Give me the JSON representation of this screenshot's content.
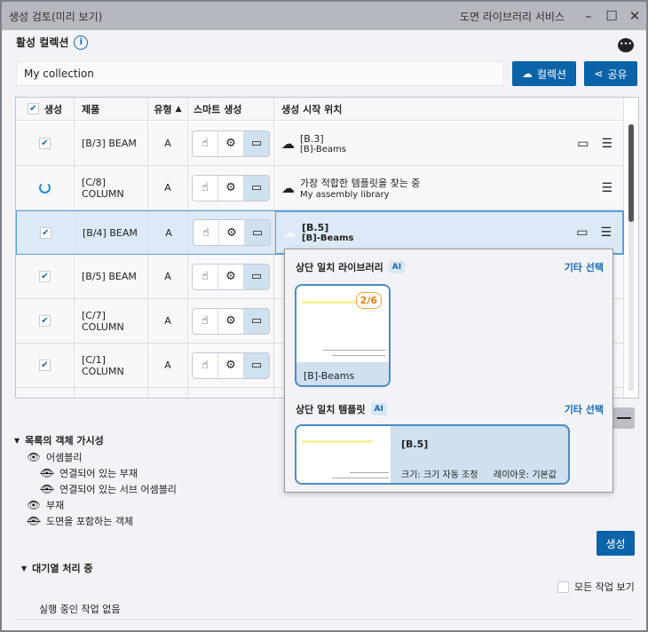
{
  "window": {
    "title": "생성 검토(미리 보기)",
    "service": "도면 라이브러리 서비스",
    "minimize": "–",
    "maximize": "☐",
    "close": "✕"
  },
  "collection": {
    "label": "활성 컬렉션",
    "info": "i",
    "value": "My collection",
    "collection_button": "컬렉션",
    "share_button": "공유"
  },
  "table": {
    "headers": {
      "generate": "생성",
      "product": "제품",
      "type": "유형",
      "sort": "▲",
      "smart": "스마트 생성",
      "location": "생성 시작 위치"
    },
    "rows": [
      {
        "state": "checked",
        "product": "[B/3] BEAM",
        "type": "A",
        "loc_title": "[B.3]",
        "loc_sub": "[B]-Beams",
        "doc": true,
        "selected": false
      },
      {
        "state": "loading",
        "product": "[C/8] COLUMN",
        "type": "A",
        "loc_title": "가장 적합한 템플릿을 찾는 중",
        "loc_sub": "My assembly library",
        "doc": false,
        "selected": false
      },
      {
        "state": "checked",
        "product": "[B/4] BEAM",
        "type": "A",
        "loc_title": "[B.5]",
        "loc_sub": "[B]-Beams",
        "doc": true,
        "selected": true
      },
      {
        "state": "checked",
        "product": "[B/5] BEAM",
        "type": "A"
      },
      {
        "state": "checked",
        "product": "[C/7] COLUMN",
        "type": "A"
      },
      {
        "state": "checked",
        "product": "[C/1] COLUMN",
        "type": "A"
      }
    ]
  },
  "popup": {
    "library_heading": "상단 일치 라이브러리",
    "ai": "AI",
    "more": "기타 선택",
    "library_card": {
      "name": "[B]-Beams",
      "badge": "2/6"
    },
    "template_heading": "상단 일치 템플릿",
    "template_card": {
      "name": "[B.5]",
      "size": "크기: 크기 자동 조정",
      "layout": "레이아웃: 기본값"
    }
  },
  "visibility": {
    "heading": "목록의 객체 가시성",
    "items": [
      "어셈블리",
      "연결되어 있는 부재",
      "연결되어 있는 서브 어셈블리",
      "부재",
      "도면을 포함하는 객체"
    ]
  },
  "generate_button": "생성",
  "queue": {
    "heading": "대기열 처리 중",
    "show_all": "모든 작업 보기",
    "empty": "실행 중인 작업 없음"
  }
}
